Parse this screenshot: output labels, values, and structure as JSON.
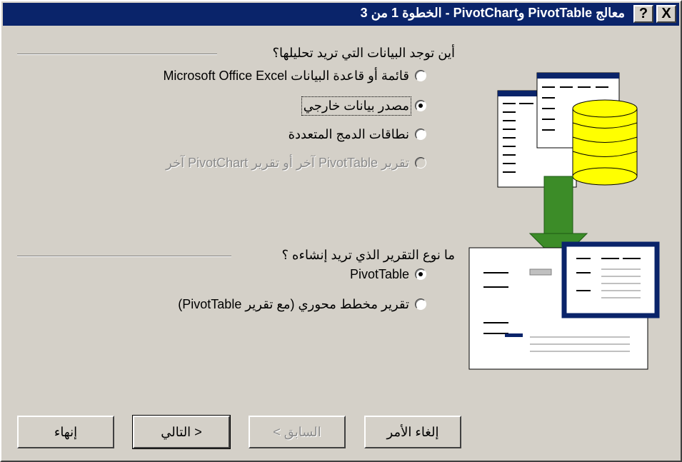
{
  "window": {
    "title": "معالج PivotTable وPivotChart  - الخطوة 1 من 3",
    "help_label": "?",
    "close_label": "X"
  },
  "section1": {
    "label": "أين توجد البيانات التي تريد تحليلها؟",
    "options": [
      {
        "label": "قائمة أو قاعدة البيانات Microsoft Office Excel",
        "checked": false,
        "disabled": false
      },
      {
        "label": "مصدر بيانات خارجي",
        "checked": true,
        "disabled": false
      },
      {
        "label": "نطاقات الدمج المتعددة",
        "checked": false,
        "disabled": false
      },
      {
        "label": "تقرير PivotTable آخر أو تقرير PivotChart آخر",
        "checked": false,
        "disabled": true
      }
    ]
  },
  "section2": {
    "label": "ما نوع التقرير الذي تريد إنشاءه ؟",
    "options": [
      {
        "label": "PivotTable",
        "checked": true,
        "disabled": false
      },
      {
        "label": "تقرير مخطط محوري (مع تقرير PivotTable)",
        "checked": false,
        "disabled": false
      }
    ]
  },
  "buttons": {
    "cancel": "إلغاء الأمر",
    "back": "< السابق",
    "next": "التالي >",
    "finish": "إنهاء"
  },
  "colors": {
    "title_bar": "#0a246a",
    "face": "#d4d0c8",
    "cylinder": "#ffff00",
    "arrow": "#3c8c28"
  }
}
